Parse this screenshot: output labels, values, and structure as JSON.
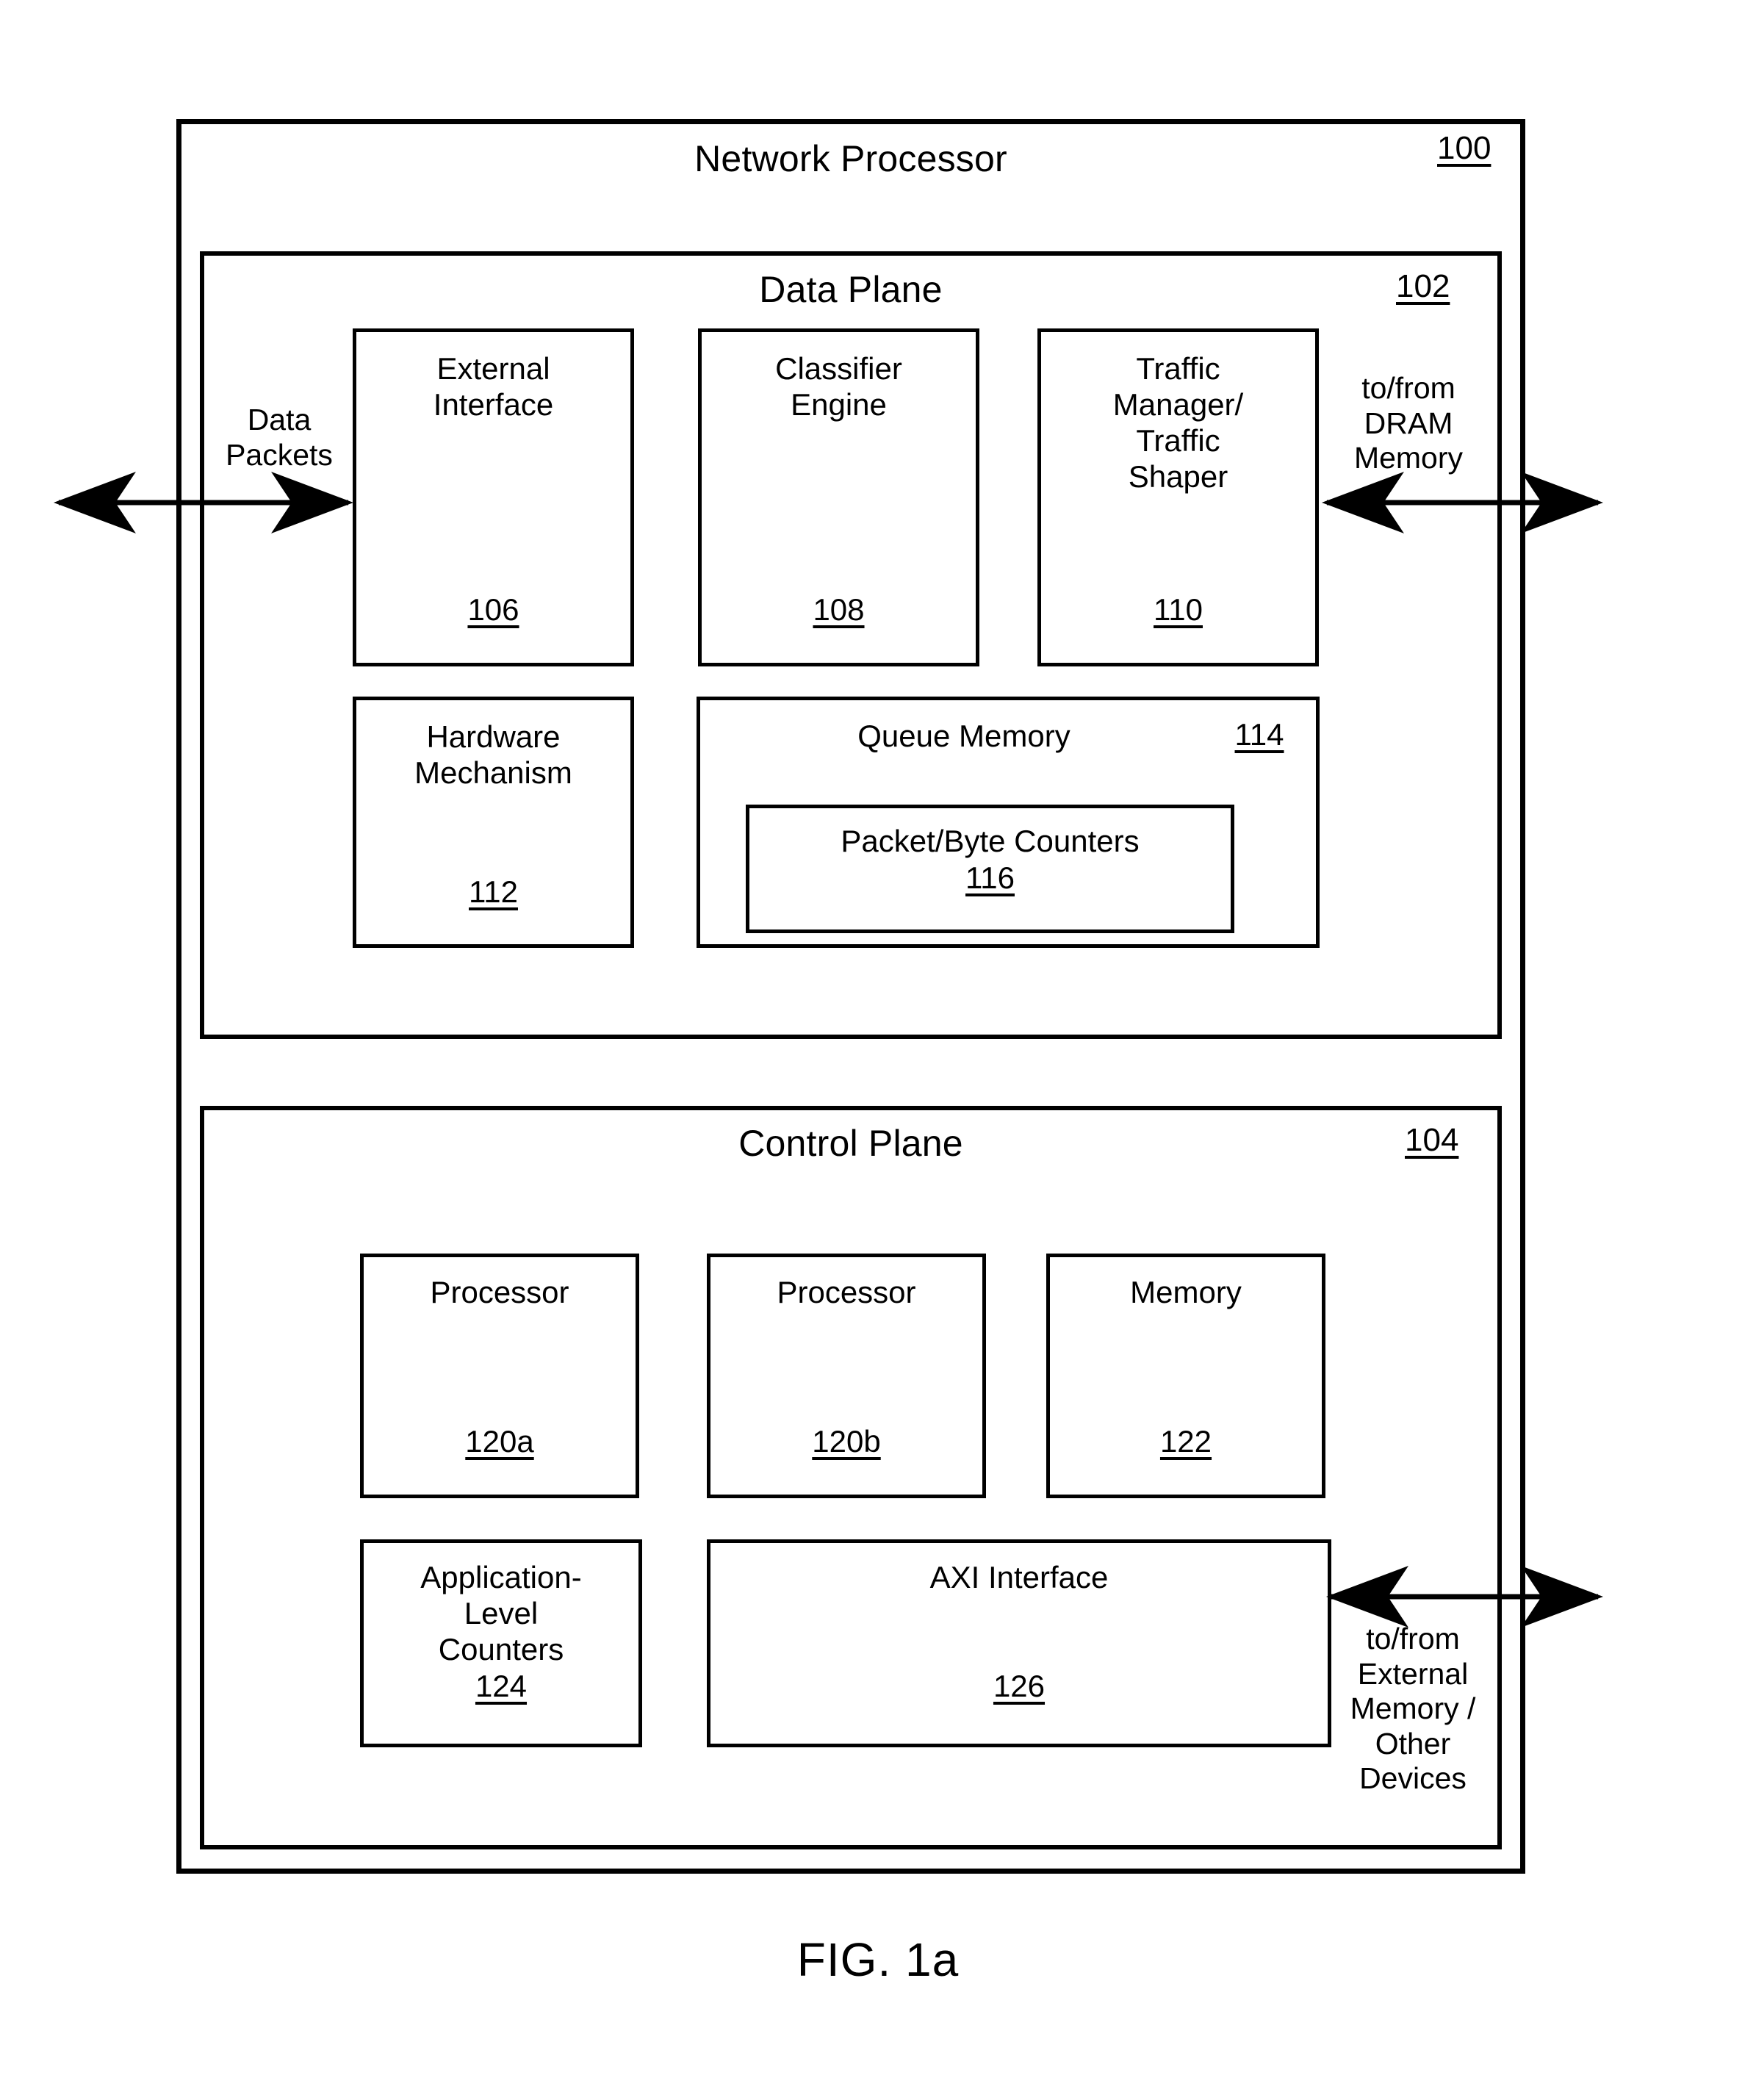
{
  "figure": {
    "caption": "FIG. 1a"
  },
  "outer": {
    "title": "Network Processor",
    "ref": "100"
  },
  "data_plane": {
    "title": "Data Plane",
    "ref": "102",
    "units": [
      {
        "label": "External\nInterface",
        "ref": "106",
        "name": "external-interface"
      },
      {
        "label": "Classifier\nEngine",
        "ref": "108",
        "name": "classifier-engine"
      },
      {
        "label": "Traffic\nManager/\nTraffic\nShaper",
        "ref": "110",
        "name": "traffic-manager-traffic-shaper"
      },
      {
        "label": "Hardware\nMechanism",
        "ref": "112",
        "name": "hardware-mechanism"
      }
    ],
    "queue_memory": {
      "label": "Queue Memory",
      "ref": "114",
      "inner": {
        "label": "Packet/Byte Counters",
        "ref": "116"
      }
    }
  },
  "control_plane": {
    "title": "Control Plane",
    "ref": "104",
    "units": [
      {
        "label": "Processor",
        "ref": "120a",
        "name": "processor-a"
      },
      {
        "label": "Processor",
        "ref": "120b",
        "name": "processor-b"
      },
      {
        "label": "Memory",
        "ref": "122",
        "name": "memory"
      },
      {
        "label": "Application-\nLevel\nCounters",
        "ref": "124",
        "name": "application-level-counters"
      },
      {
        "label": "AXI Interface",
        "ref": "126",
        "name": "axi-interface"
      }
    ]
  },
  "io_labels": {
    "data_packets": "Data\nPackets",
    "dram": "to/from\nDRAM\nMemory",
    "external": "to/from\nExternal\nMemory /\nOther\nDevices"
  }
}
